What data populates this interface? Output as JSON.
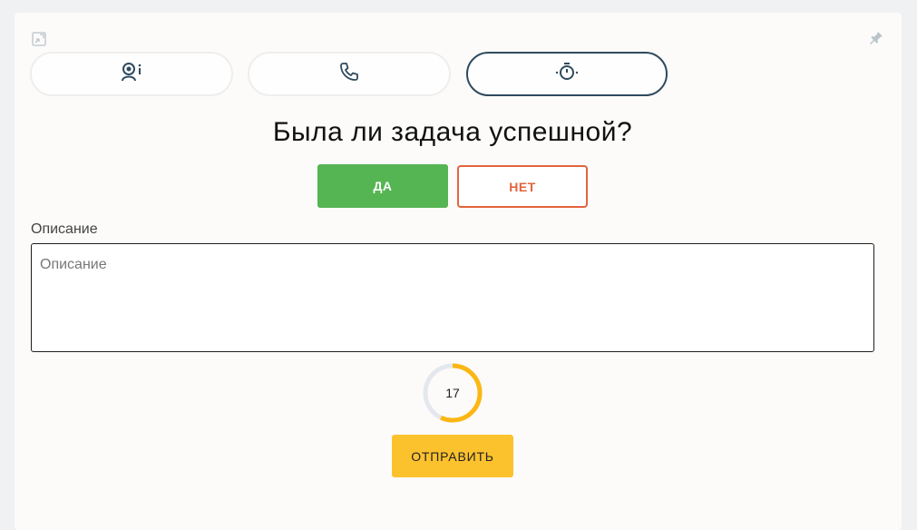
{
  "header": {
    "minimize_icon": "minimize-icon",
    "pin_icon": "pin-icon"
  },
  "tabs": [
    {
      "icon": "operator-info-icon",
      "active": false
    },
    {
      "icon": "phone-icon",
      "active": false
    },
    {
      "icon": "stopwatch-icon",
      "active": true
    }
  ],
  "question": "Была ли задача успешной?",
  "buttons": {
    "yes_label": "ДА",
    "no_label": "НЕТ",
    "submit_label": "ОТПРАВИТЬ"
  },
  "description": {
    "label": "Описание",
    "placeholder": "Описание",
    "value": ""
  },
  "timer": {
    "value": "17",
    "progress_fraction": 0.57
  },
  "colors": {
    "yes": "#55b553",
    "no": "#e3643e",
    "submit": "#fcc22e",
    "active_tab_border": "#2f4a5e",
    "timer_progress": "#fcb714",
    "timer_track": "#e4e8ee",
    "icon": "#2f4a5e"
  }
}
